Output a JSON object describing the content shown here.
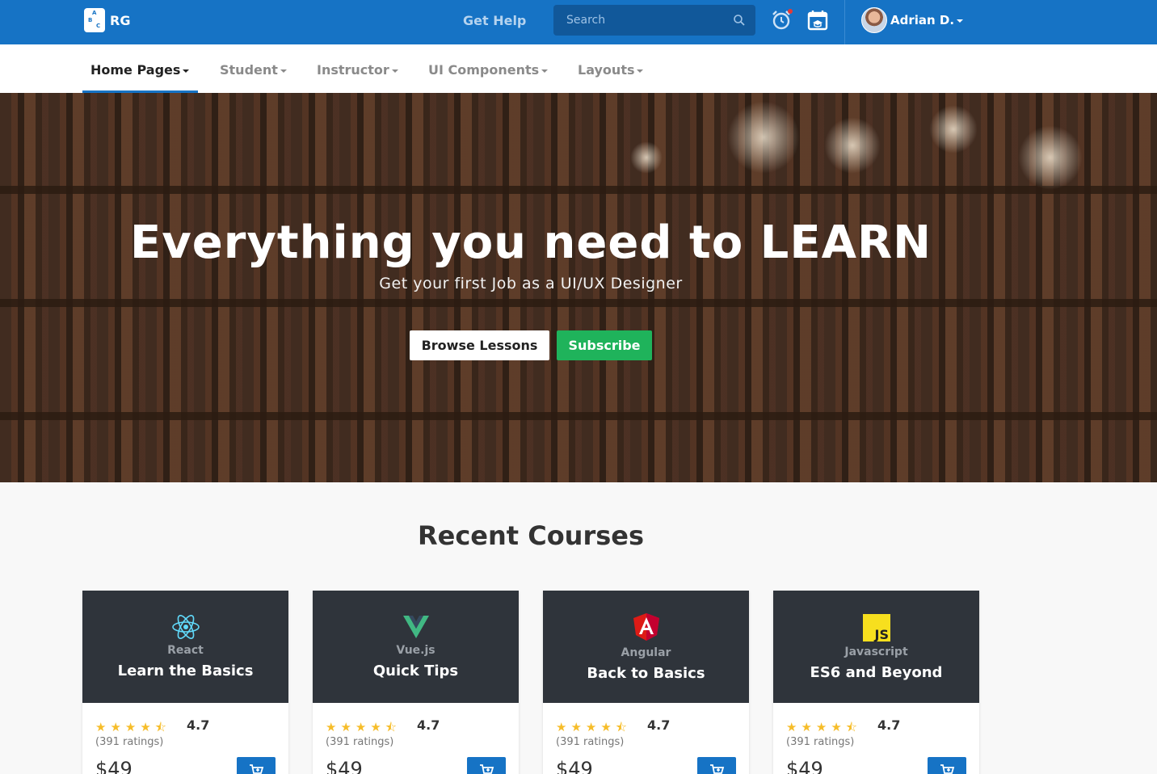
{
  "topbar": {
    "brand": "RG",
    "logo_letters": [
      "A",
      "B",
      "C"
    ],
    "get_help": "Get Help",
    "search_placeholder": "Search",
    "user_name": "Adrian D.",
    "icons": [
      "search-icon",
      "alarm-clock-icon",
      "calendar-icon",
      "avatar"
    ]
  },
  "nav": {
    "items": [
      {
        "label": "Home Pages",
        "active": true
      },
      {
        "label": "Student",
        "active": false
      },
      {
        "label": "Instructor",
        "active": false
      },
      {
        "label": "UI Components",
        "active": false
      },
      {
        "label": "Layouts",
        "active": false
      }
    ]
  },
  "hero": {
    "title": "Everything you need to LEARN",
    "subtitle": "Get your first Job as a UI/UX Designer",
    "browse_label": "Browse Lessons",
    "subscribe_label": "Subscribe"
  },
  "courses": {
    "section_title": "Recent Courses",
    "items": [
      {
        "category": "React",
        "title": "Learn the Basics",
        "stars": "★★★★⯪",
        "rating": "4.7",
        "ratings_count": "(391 ratings)",
        "price": "$49",
        "icon": "react-icon"
      },
      {
        "category": "Vue.js",
        "title": "Quick Tips",
        "stars": "★★★★⯪",
        "rating": "4.7",
        "ratings_count": "(391 ratings)",
        "price": "$49",
        "icon": "vue-icon"
      },
      {
        "category": "Angular",
        "title": "Back to Basics",
        "stars": "★★★★⯪",
        "rating": "4.7",
        "ratings_count": "(391 ratings)",
        "price": "$49",
        "icon": "angular-icon"
      },
      {
        "category": "Javascript",
        "title": "ES6 and Beyond",
        "stars": "★★★★⯪",
        "rating": "4.7",
        "ratings_count": "(391 ratings)",
        "price": "$49",
        "icon": "javascript-icon"
      }
    ]
  },
  "colors": {
    "primary": "#1673c5",
    "success": "#1fb35b",
    "card_header": "#2f343b",
    "star": "#f6bd2a"
  }
}
